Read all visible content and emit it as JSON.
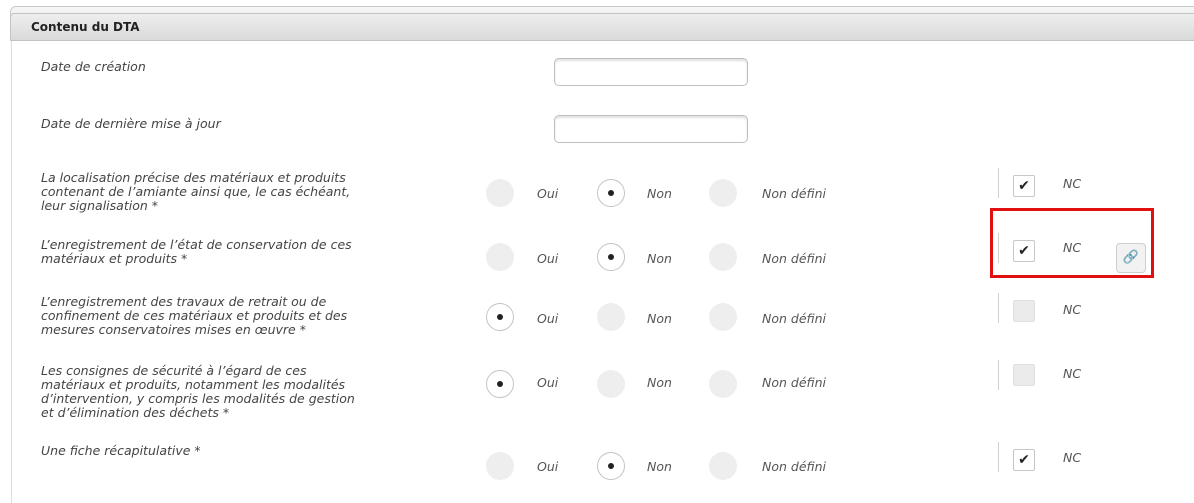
{
  "panel": {
    "title": "Contenu du DTA"
  },
  "fields": {
    "creation_date": {
      "label": "Date de création",
      "value": ""
    },
    "update_date": {
      "label": "Date de dernière mise à jour",
      "value": ""
    }
  },
  "options": {
    "oui": "Oui",
    "non": "Non",
    "non_defini": "Non défini"
  },
  "nc_label": "NC",
  "rows": [
    {
      "label": "La localisation précise des matériaux et produits\ncontenant de l’amiante ainsi que, le cas échéant,\nleur signalisation *",
      "selected": "non",
      "nc": true
    },
    {
      "label": "L’enregistrement de l’état de conservation de ces\nmatériaux et produits *",
      "selected": "non",
      "nc": true
    },
    {
      "label": "L’enregistrement des travaux de retrait ou de\nconfinement de ces matériaux et produits et des\nmesures conservatoires mises en œuvre *",
      "selected": "oui",
      "nc": false
    },
    {
      "label": "Les consignes de sécurité à l’égard de ces\nmatériaux et produits, notamment les modalités\nd’intervention, y compris les modalités de gestion\net d’élimination des déchets *",
      "selected": "oui",
      "nc": false
    },
    {
      "label": "Une fiche récapitulative *",
      "selected": "non",
      "nc": true
    }
  ],
  "icons": {
    "check": "checkmark-icon",
    "link": "link-icon"
  },
  "colors": {
    "highlight": "#e01010"
  }
}
